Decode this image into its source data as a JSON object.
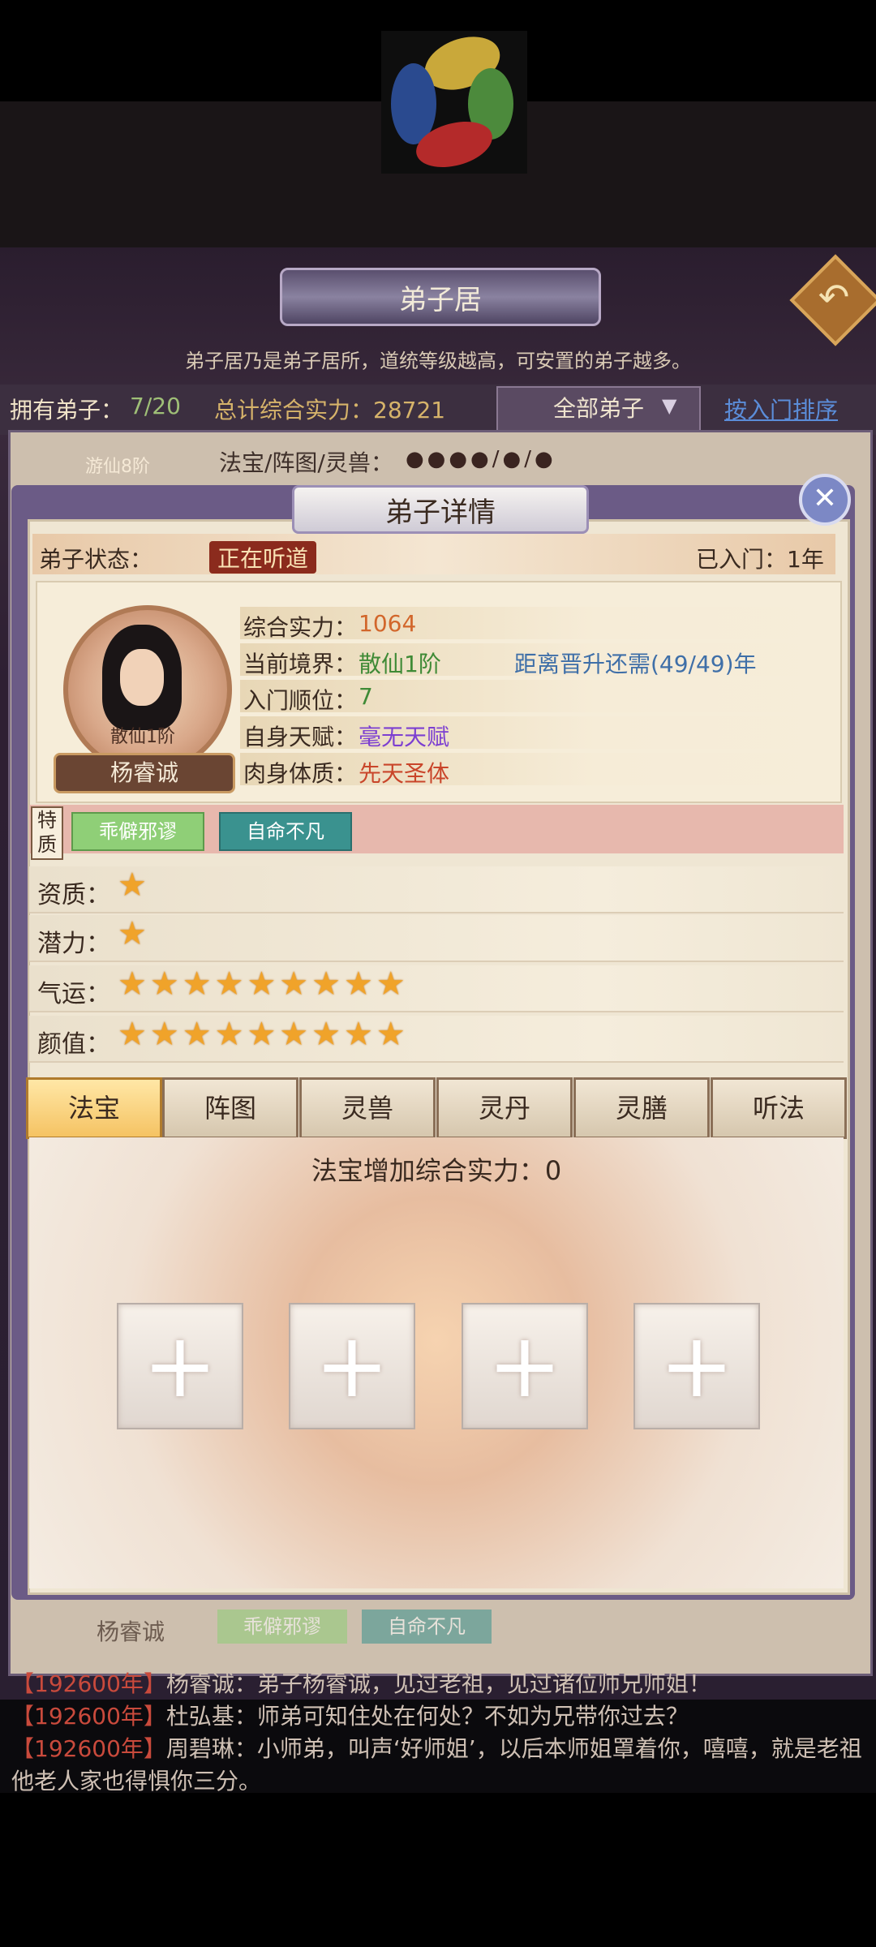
{
  "header": {
    "title": "弟子居",
    "subtitle": "弟子居乃是弟子居所，道统等级越高，可安置的弟子越多。"
  },
  "status_bar": {
    "own_label": "拥有弟子：",
    "own_value": "7/20",
    "total_label": "总计综合实力：28721",
    "filter": "全部弟子",
    "sort_link": "按入门排序"
  },
  "list_behind": {
    "rank": "游仙8阶",
    "treasure_label": "法宝/阵图/灵兽：",
    "dots": "●●●●/●/●",
    "name": "杨睿诚",
    "tag1": "乖僻邪谬",
    "tag2": "自命不凡"
  },
  "modal": {
    "title": "弟子详情",
    "state_label": "弟子状态：",
    "state_value": "正在听道",
    "joined": "已入门：1年",
    "portrait_rank": "散仙1阶",
    "name": "杨睿诚",
    "info": [
      {
        "label": "综合实力：",
        "value": "1064",
        "color": "#d2662b"
      },
      {
        "label": "当前境界：",
        "value": "散仙1阶",
        "color": "#3f8a36"
      },
      {
        "label": "入门顺位：",
        "value": "7",
        "color": "#3f8a36"
      },
      {
        "label": "自身天赋：",
        "value": "毫无天赋",
        "color": "#7c3fd1"
      },
      {
        "label": "肉身体质：",
        "value": "先天圣体",
        "color": "#c9452a"
      }
    ],
    "ascend_text": "距离晋升还需(49/49)年",
    "trait_label": "特质",
    "traits": [
      "乖僻邪谬",
      "自命不凡"
    ],
    "stats": [
      {
        "label": "资质：",
        "stars": 1
      },
      {
        "label": "潜力：",
        "stars": 1
      },
      {
        "label": "气运：",
        "stars": 9
      },
      {
        "label": "颜值：",
        "stars": 9
      }
    ],
    "tabs": [
      "法宝",
      "阵图",
      "灵兽",
      "灵丹",
      "灵膳",
      "听法"
    ],
    "active_tab": 0,
    "power_text": "法宝增加综合实力：0",
    "slots": 4
  },
  "chat": [
    {
      "ts": "【192600年】",
      "who": "杨睿诚：",
      "text": "弟子杨睿诚，见过老祖，见过诸位师兄师姐！"
    },
    {
      "ts": "【192600年】",
      "who": "杜弘基：",
      "text": "师弟可知住处在何处？不如为兄带你过去？"
    },
    {
      "ts": "【192600年】",
      "who": "周碧琳：",
      "text": "小师弟，叫声‘好师姐’，以后本师姐罩着你，嘻嘻，就是老祖他老人家也得惧你三分。"
    }
  ],
  "colors": {
    "accent_gold": "#f5c363",
    "modal_frame": "#6b5b86"
  }
}
